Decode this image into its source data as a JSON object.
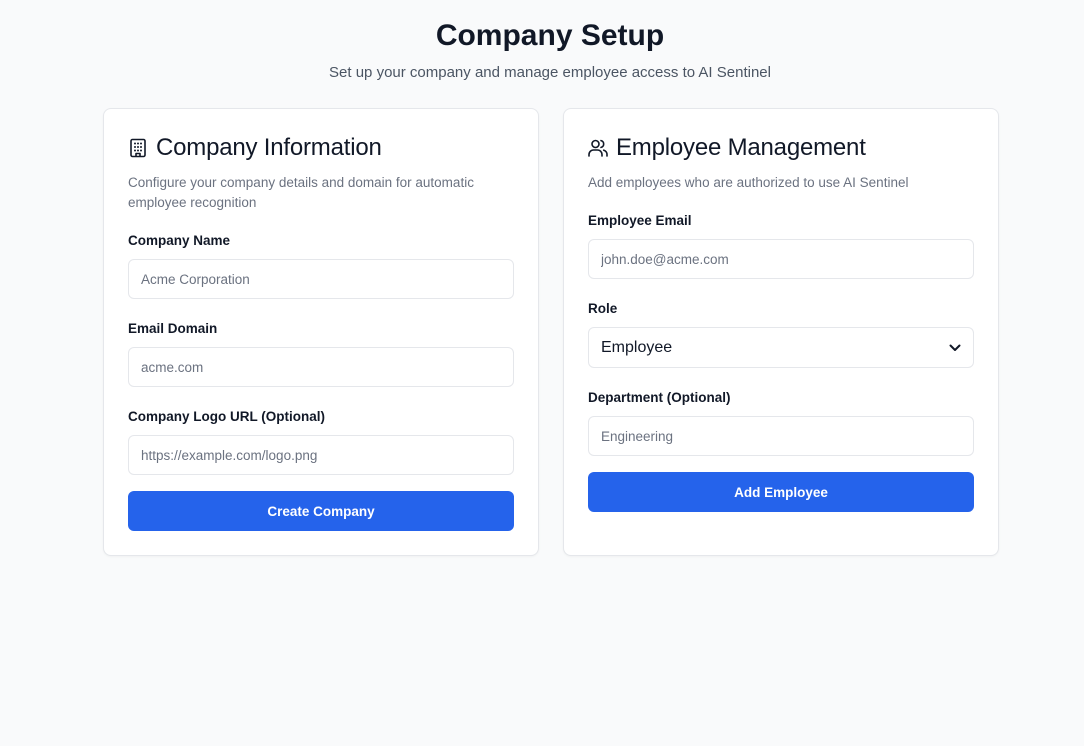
{
  "header": {
    "title": "Company Setup",
    "subtitle": "Set up your company and manage employee access to AI Sentinel"
  },
  "company_card": {
    "icon": "building-icon",
    "title": "Company Information",
    "description": "Configure your company details and domain for automatic employee recognition",
    "fields": {
      "name": {
        "label": "Company Name",
        "value": "",
        "placeholder": "Acme Corporation"
      },
      "domain": {
        "label": "Email Domain",
        "value": "",
        "placeholder": "acme.com"
      },
      "logo": {
        "label": "Company Logo URL (Optional)",
        "value": "",
        "placeholder": "https://example.com/logo.png"
      }
    },
    "submit_label": "Create Company"
  },
  "employee_card": {
    "icon": "users-icon",
    "title": "Employee Management",
    "description": "Add employees who are authorized to use AI Sentinel",
    "fields": {
      "email": {
        "label": "Employee Email",
        "value": "",
        "placeholder": "john.doe@acme.com"
      },
      "role": {
        "label": "Role",
        "selected": "Employee"
      },
      "department": {
        "label": "Department (Optional)",
        "value": "",
        "placeholder": "Engineering"
      }
    },
    "submit_label": "Add Employee"
  },
  "colors": {
    "primary": "#2563eb",
    "background": "#f9fafb",
    "card_border": "#e5e7eb",
    "text": "#111827",
    "muted": "#6b7280"
  }
}
